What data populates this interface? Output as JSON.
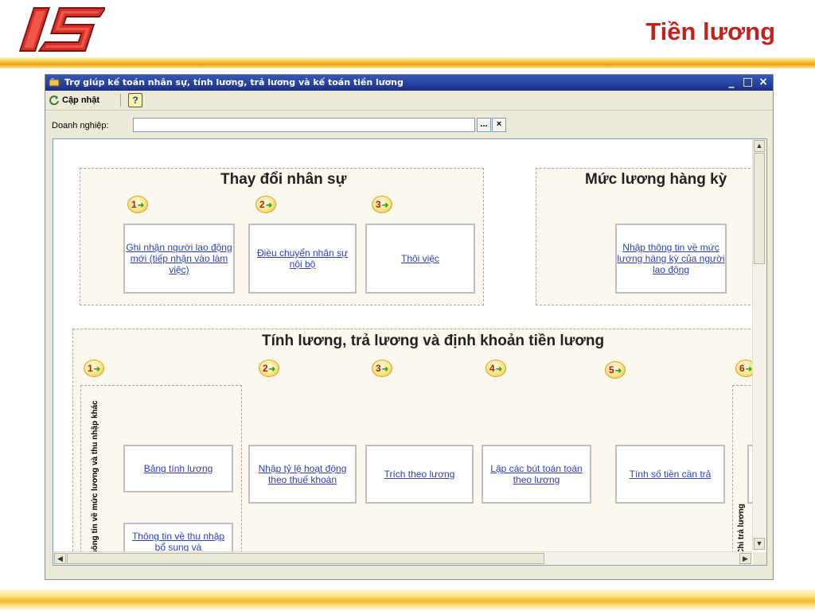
{
  "slide": {
    "logo_text": "IS",
    "title": "Tiền lương"
  },
  "window": {
    "title": "Trợ giúp kế toán nhân sự, tính lương, trả lương và kế toán tiền lương",
    "controls": {
      "minimize": "_",
      "maximize": "□",
      "close": "×"
    }
  },
  "toolbar": {
    "update_label": "Cập nhật",
    "help_label": "?"
  },
  "company": {
    "label": "Doanh nghiệp:",
    "value": "",
    "browse": "...",
    "clear": "×"
  },
  "hr_changes": {
    "title": "Thay đổi nhân sự",
    "steps": [
      "1",
      "2",
      "3"
    ],
    "tasks": [
      "Ghi nhận người lao động mới (tiếp nhận vào làm việc)",
      "Điều chuyển nhân sự nội bộ",
      "Thôi việc"
    ]
  },
  "period_salary": {
    "title": "Mức lương hàng kỳ",
    "task": "Nhập thông tin về mức lương hàng kỳ của người lao động"
  },
  "payroll": {
    "title": "Tính lương, trả lương và định khoản tiền lương",
    "steps": [
      "1",
      "2",
      "3",
      "4",
      "5",
      "6"
    ],
    "column1_label": "Thông tin về mức lương và thu nhập khác",
    "column6_label": "Chi trả lương",
    "tasks": {
      "payroll_sheet": "Bảng tính lương",
      "supplementary_income": "Thông tin về thu nhập bổ sung và",
      "contract_rate": "Nhập tỷ lệ hoạt động theo thuế khoán",
      "deduction": "Trích theo lương",
      "entries": "Lập các bút toán toán theo lương",
      "amount_to_pay": "Tính số tiền cần trả"
    }
  }
}
